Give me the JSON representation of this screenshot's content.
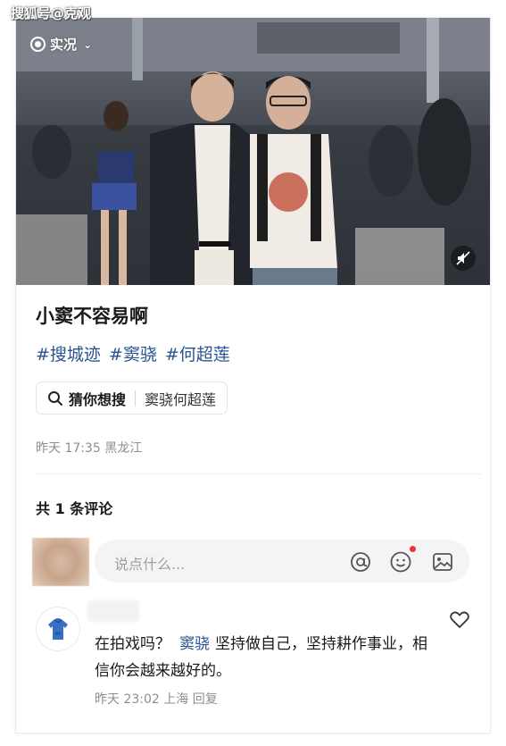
{
  "watermark": "搜狐号@克观",
  "photo": {
    "live_label": "实况",
    "live_icon": "live-photo-icon",
    "expand_icon": "chevron-down-icon",
    "mute_icon": "speaker-muted-icon"
  },
  "post": {
    "title": "小窦不容易啊",
    "tags": [
      "#搜城迹",
      "#窦骁",
      "#何超莲"
    ],
    "search": {
      "label": "猜你想搜",
      "query": "窦骁何超莲"
    },
    "meta": "昨天 17:35 黑龙江"
  },
  "comments": {
    "count_label": "共 1 条评论",
    "input_placeholder": "说点什么...",
    "input_icons": [
      "at-icon",
      "emoji-icon",
      "image-icon"
    ],
    "items": [
      {
        "text_before": "在拍戏吗？",
        "mention": "窦骁",
        "text_after": "坚持做自己，坚持耕作事业，相信你会越来越好的。",
        "meta": "昨天 23:02 上海 回复"
      }
    ]
  },
  "colors": {
    "link": "#2b5591",
    "muted": "#8e8e8e",
    "notification": "#e8333b"
  }
}
